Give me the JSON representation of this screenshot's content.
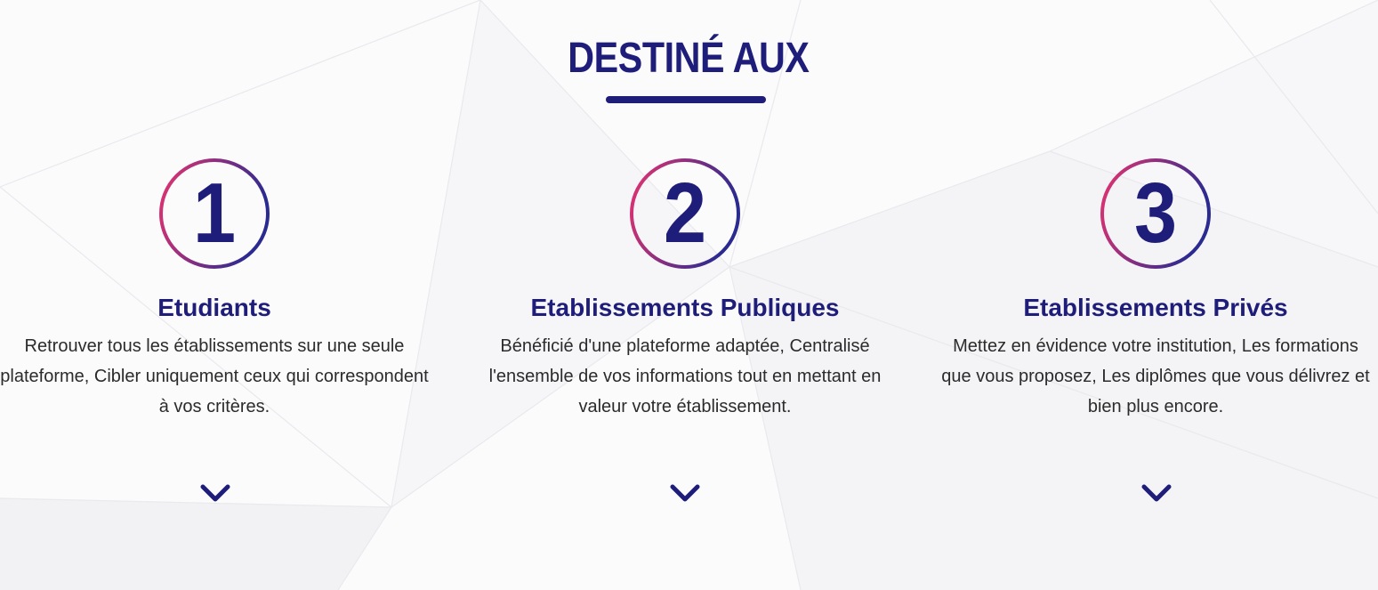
{
  "section": {
    "title": "DESTINÉ AUX",
    "accent_color": "#1f1d7a",
    "ring_gradient": [
      "#e8336f",
      "#2a2a90"
    ]
  },
  "columns": [
    {
      "number": "1",
      "heading": "Etudiants",
      "text": "Retrouver tous les établissements sur une seule plateforme, Cibler uniquement ceux qui correspondent à vos critères.",
      "icon": "chevron-down-icon"
    },
    {
      "number": "2",
      "heading": "Etablissements Publiques",
      "text": "Bénéficié d'une plateforme adaptée, Centralisé l'ensemble de vos informations tout en mettant en valeur votre établissement.",
      "icon": "chevron-down-icon"
    },
    {
      "number": "3",
      "heading": "Etablissements Privés",
      "text": "Mettez en évidence votre institution, Les formations que vous proposez, Les diplômes que vous délivrez et bien plus encore.",
      "icon": "chevron-down-icon"
    }
  ]
}
